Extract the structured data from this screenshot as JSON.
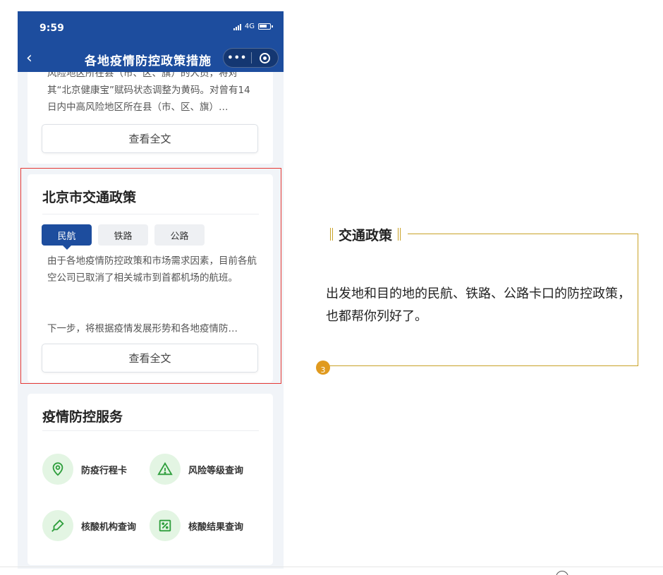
{
  "status_bar": {
    "time": "9:59",
    "network": "4G"
  },
  "nav": {
    "back_icon": "chevron-left-icon",
    "title": "各地疫情防控政策措施",
    "more_label": "•••",
    "target_icon": "record-target-icon"
  },
  "card_prev": {
    "text": "风险地区所在县（市、区、旗）的人员，将对其“北京健康宝”赋码状态调整为黄码。对曾有14日内中高风险地区所在县（市、区、旗）…",
    "button": "查看全文"
  },
  "card_transport": {
    "title": "北京市交通政策",
    "tabs": [
      "民航",
      "铁路",
      "公路"
    ],
    "active_tab": "民航",
    "text1": "由于各地疫情防控政策和市场需求因素，目前各航空公司已取消了相关城市到首都机场的航班。",
    "text2": "下一步，将根据疫情发展形势和各地疫情防…",
    "button": "查看全文"
  },
  "card_services": {
    "title": "疫情防控服务",
    "items": [
      {
        "label": "防疫行程卡",
        "icon": "location-pin-icon"
      },
      {
        "label": "风险等级查询",
        "icon": "warning-triangle-icon"
      },
      {
        "label": "核酸机构查询",
        "icon": "dropper-icon"
      },
      {
        "label": "核酸结果查询",
        "icon": "test-report-icon"
      }
    ]
  },
  "callout": {
    "title": "交通政策",
    "text": "出发地和目的地的民航、铁路、公路卡口的防控政策，也都帮你列好了。",
    "step": "3"
  },
  "colors": {
    "brand": "#1d4d9e",
    "highlight": "#e53935",
    "accent": "#c9a227",
    "badge": "#e09a1f",
    "service_bg": "#e3f5e3",
    "service_icon": "#2e9e3c"
  }
}
